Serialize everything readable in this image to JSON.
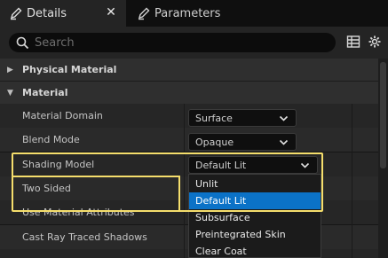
{
  "tabs": [
    {
      "label": "Details",
      "active": true
    },
    {
      "label": "Parameters",
      "active": false
    }
  ],
  "search": {
    "placeholder": "Search"
  },
  "categories": [
    {
      "label": "Physical Material",
      "expanded": false
    },
    {
      "label": "Material",
      "expanded": true
    }
  ],
  "properties": [
    {
      "label": "Material Domain",
      "value": "Surface"
    },
    {
      "label": "Blend Mode",
      "value": "Opaque"
    },
    {
      "label": "Shading Model",
      "value": "Default Lit"
    },
    {
      "label": "Two Sided"
    },
    {
      "label": "Use Material Attributes"
    },
    {
      "label": "Cast Ray Traced Shadows"
    }
  ],
  "dropdown": {
    "options": [
      "Unlit",
      "Default Lit",
      "Subsurface",
      "Preintegrated Skin",
      "Clear Coat"
    ],
    "selected": "Default Lit"
  },
  "colors": {
    "highlight": "#f5de6c",
    "selection": "#0b72c7",
    "panel": "#262626"
  }
}
